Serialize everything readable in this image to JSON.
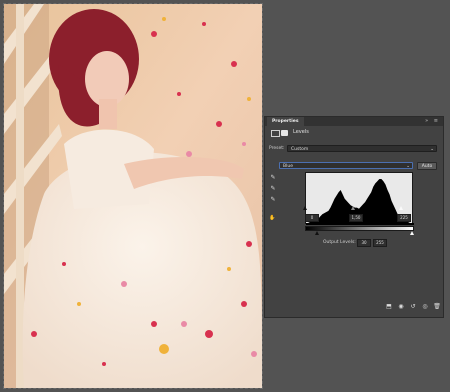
{
  "panel": {
    "tab_label": "Properties",
    "panel_controls": "»  ≡",
    "adjustment_title": "Levels",
    "preset_label": "Preset:",
    "preset_value": "Custom",
    "channel_value": "Blue",
    "auto_label": "Auto",
    "input_black": "0",
    "input_gamma": "1,50",
    "input_white": "225",
    "output_label": "Output Levels:",
    "output_black": "30",
    "output_white": "255"
  },
  "histogram_data": {
    "type": "area",
    "values": [
      0,
      0,
      1,
      1,
      2,
      3,
      4,
      6,
      8,
      9,
      10,
      11,
      14,
      18,
      22,
      25,
      28,
      30,
      26,
      22,
      20,
      18,
      16,
      15,
      14,
      14,
      13,
      15,
      17,
      19,
      22,
      25,
      28,
      33,
      36,
      38,
      40,
      40,
      38,
      35,
      30,
      26,
      20,
      16,
      12,
      8,
      5,
      3,
      2,
      1,
      1,
      0,
      0,
      0
    ]
  },
  "colors": {
    "panel_bg": "#424242",
    "workspace_bg": "#535353"
  },
  "icons": {
    "eyedropper_black": "eyedropper-black-icon",
    "eyedropper_gray": "eyedropper-gray-icon",
    "eyedropper_white": "eyedropper-white-icon",
    "target": "target-adjust-icon"
  }
}
